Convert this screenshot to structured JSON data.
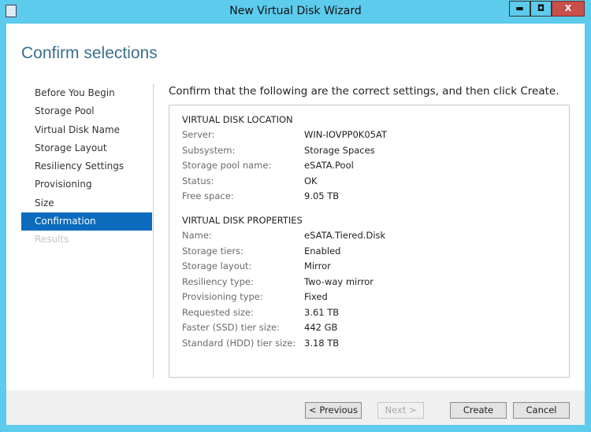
{
  "window": {
    "title": "New Virtual Disk Wizard",
    "minimize": "▬",
    "maximize": "◘",
    "close": "X"
  },
  "heading": "Confirm selections",
  "nav": [
    "Before You Begin",
    "Storage Pool",
    "Virtual Disk Name",
    "Storage Layout",
    "Resiliency Settings",
    "Provisioning",
    "Size",
    "Confirmation",
    "Results"
  ],
  "intro": "Confirm that the following are the correct settings, and then click Create.",
  "location": {
    "title": "VIRTUAL DISK LOCATION",
    "rows": [
      {
        "k": "Server:",
        "v": "WIN-IOVPP0K05AT"
      },
      {
        "k": "Subsystem:",
        "v": "Storage Spaces"
      },
      {
        "k": "Storage pool name:",
        "v": "eSATA.Pool"
      },
      {
        "k": "Status:",
        "v": "OK"
      },
      {
        "k": "Free space:",
        "v": "9.05 TB"
      }
    ]
  },
  "properties": {
    "title": "VIRTUAL DISK PROPERTIES",
    "rows": [
      {
        "k": "Name:",
        "v": "eSATA.Tiered.Disk"
      },
      {
        "k": "Storage tiers:",
        "v": "Enabled"
      },
      {
        "k": "Storage layout:",
        "v": "Mirror"
      },
      {
        "k": "Resiliency type:",
        "v": "Two-way mirror"
      },
      {
        "k": "Provisioning type:",
        "v": "Fixed"
      },
      {
        "k": "Requested size:",
        "v": "3.61 TB"
      },
      {
        "k": "Faster (SSD) tier size:",
        "v": "442 GB"
      },
      {
        "k": "Standard (HDD) tier size:",
        "v": "3.18 TB"
      }
    ]
  },
  "buttons": {
    "previous": "< Previous",
    "next": "Next >",
    "create": "Create",
    "cancel": "Cancel"
  }
}
